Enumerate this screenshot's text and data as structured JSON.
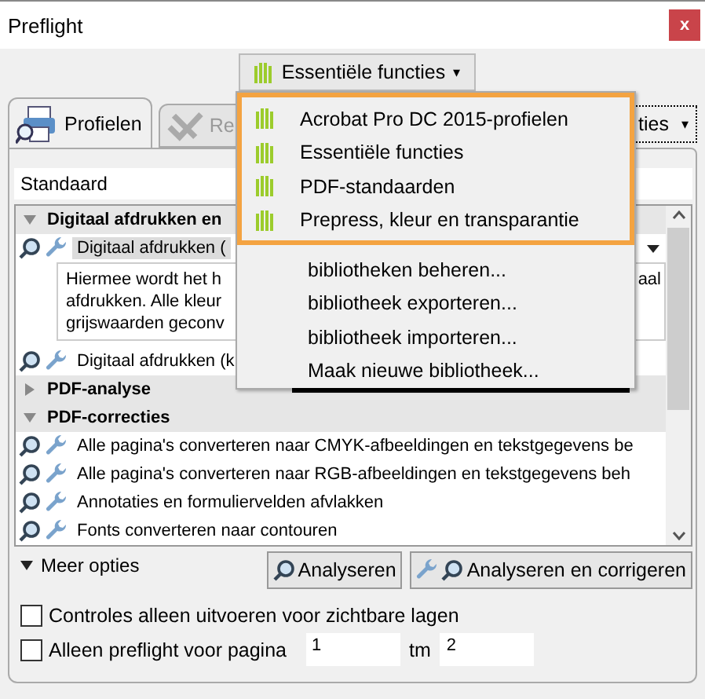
{
  "window": {
    "title": "Preflight",
    "close": "x"
  },
  "library_button": {
    "label": "Essentiële functies",
    "caret": "▾"
  },
  "tabs": [
    {
      "label": "Profielen",
      "selected": true,
      "disabled": false
    },
    {
      "label": "Re",
      "selected": false,
      "disabled": true
    }
  ],
  "options_button": {
    "label": "ties",
    "caret": "▾"
  },
  "profile_field": {
    "value": "Standaard"
  },
  "list": {
    "items": [
      {
        "kind": "group",
        "label": "Digitaal afdrukken en",
        "expanded": true
      },
      {
        "kind": "profile",
        "label": "Digitaal afdrukken (",
        "selected": true
      },
      {
        "kind": "description",
        "lines": [
          "Hiermee wordt het h",
          "afdrukken. Alle kleur",
          "grijswaarden geconv"
        ],
        "first_line_end": "aal"
      },
      {
        "kind": "profile",
        "label": "Digitaal afdrukken (k",
        "selected": false
      },
      {
        "kind": "group",
        "label": "PDF-analyse",
        "expanded": false
      },
      {
        "kind": "group",
        "label": "PDF-correcties",
        "expanded": true
      },
      {
        "kind": "profile",
        "label": "Alle pagina's converteren naar CMYK-afbeeldingen en tekstgegevens be",
        "selected": false
      },
      {
        "kind": "profile",
        "label": "Alle pagina's converteren naar RGB-afbeeldingen en tekstgegevens beh",
        "selected": false
      },
      {
        "kind": "profile",
        "label": "Annotaties en formuliervelden afvlakken",
        "selected": false
      },
      {
        "kind": "profile",
        "label": "Fonts converteren naar contouren",
        "selected": false
      }
    ]
  },
  "more_options": {
    "label": "Meer opties",
    "expanded": true
  },
  "buttons": [
    {
      "kind": "analyze",
      "label": "Analyseren"
    },
    {
      "kind": "fix",
      "label": "Analyseren en corrigeren"
    }
  ],
  "checkboxes": [
    {
      "label": "Controles alleen uitvoeren voor zichtbare lagen",
      "checked": false
    },
    {
      "label": "Alleen preflight voor pagina",
      "checked": false
    }
  ],
  "page_range": {
    "from": "1",
    "to_label": "tm",
    "to": "2"
  },
  "menu": {
    "items": [
      {
        "kind": "library",
        "label": "Acrobat Pro DC 2015-profielen"
      },
      {
        "kind": "library",
        "label": "Essentiële functies"
      },
      {
        "kind": "library",
        "label": "PDF-standaarden"
      },
      {
        "kind": "library",
        "label": "Prepress, kleur en transparantie"
      },
      {
        "kind": "action",
        "label": "bibliotheken beheren..."
      },
      {
        "kind": "action",
        "label": "bibliotheek exporteren..."
      },
      {
        "kind": "action",
        "label": "bibliotheek importeren..."
      },
      {
        "kind": "action",
        "label": "Maak nieuwe bibliotheek..."
      }
    ]
  }
}
